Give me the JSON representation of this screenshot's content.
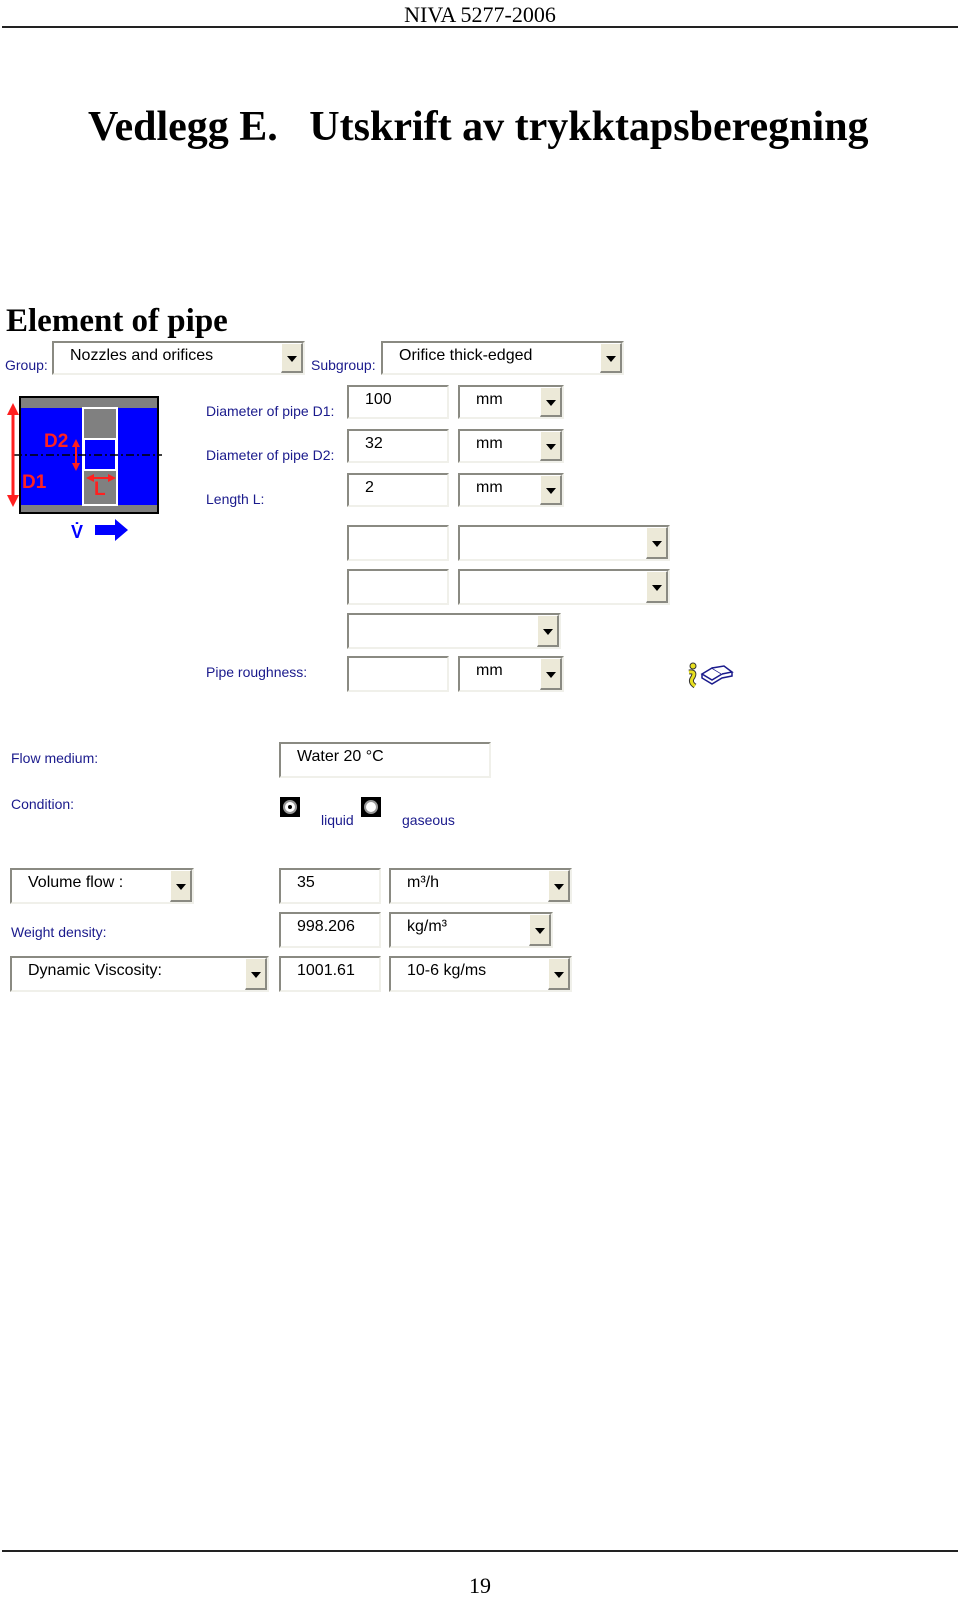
{
  "header": {
    "report_id": "NIVA 5277-2006"
  },
  "title": "Vedlegg E.   Utskrift av trykktapsberegning",
  "section_title": "Element of pipe",
  "group": {
    "label": "Group:",
    "value": "Nozzles and orifices"
  },
  "subgroup": {
    "label": "Subgroup:",
    "value": "Orifice thick-edged"
  },
  "diagram": {
    "labels": {
      "d1": "D1",
      "d2": "D2",
      "l": "L",
      "v": "V̇"
    },
    "colors": {
      "pipe": "#0000ff",
      "wall": "#808080",
      "dimension": "#ff2020"
    }
  },
  "params": [
    {
      "label": "Diameter of pipe D1:",
      "value": "100",
      "unit": "mm"
    },
    {
      "label": "Diameter of pipe D2:",
      "value": "32",
      "unit": "mm"
    },
    {
      "label": "Length L:",
      "value": "2",
      "unit": "mm"
    }
  ],
  "empty_rows": [
    {
      "value": "",
      "unit": ""
    },
    {
      "value": "",
      "unit": ""
    }
  ],
  "empty_combo": {
    "value": ""
  },
  "roughness": {
    "label": "Pipe roughness:",
    "value": "",
    "unit": "mm"
  },
  "icons": {
    "info": "info-icon",
    "book": "book-icon"
  },
  "flow_medium": {
    "label": "Flow medium:",
    "value": "Water 20 °C"
  },
  "condition": {
    "label": "Condition:",
    "options": [
      {
        "label": "liquid",
        "selected": true
      },
      {
        "label": "gaseous",
        "selected": false
      }
    ]
  },
  "volume_flow": {
    "label": "Volume flow :",
    "value": "35",
    "unit": "m³/h"
  },
  "weight_density": {
    "label": "Weight density:",
    "value": "998.206",
    "unit": "kg/m³"
  },
  "dynamic_viscosity": {
    "label": "Dynamic Viscosity:",
    "value": "1001.61",
    "unit": "10-6 kg/ms"
  },
  "footer": {
    "page_number": "19"
  }
}
